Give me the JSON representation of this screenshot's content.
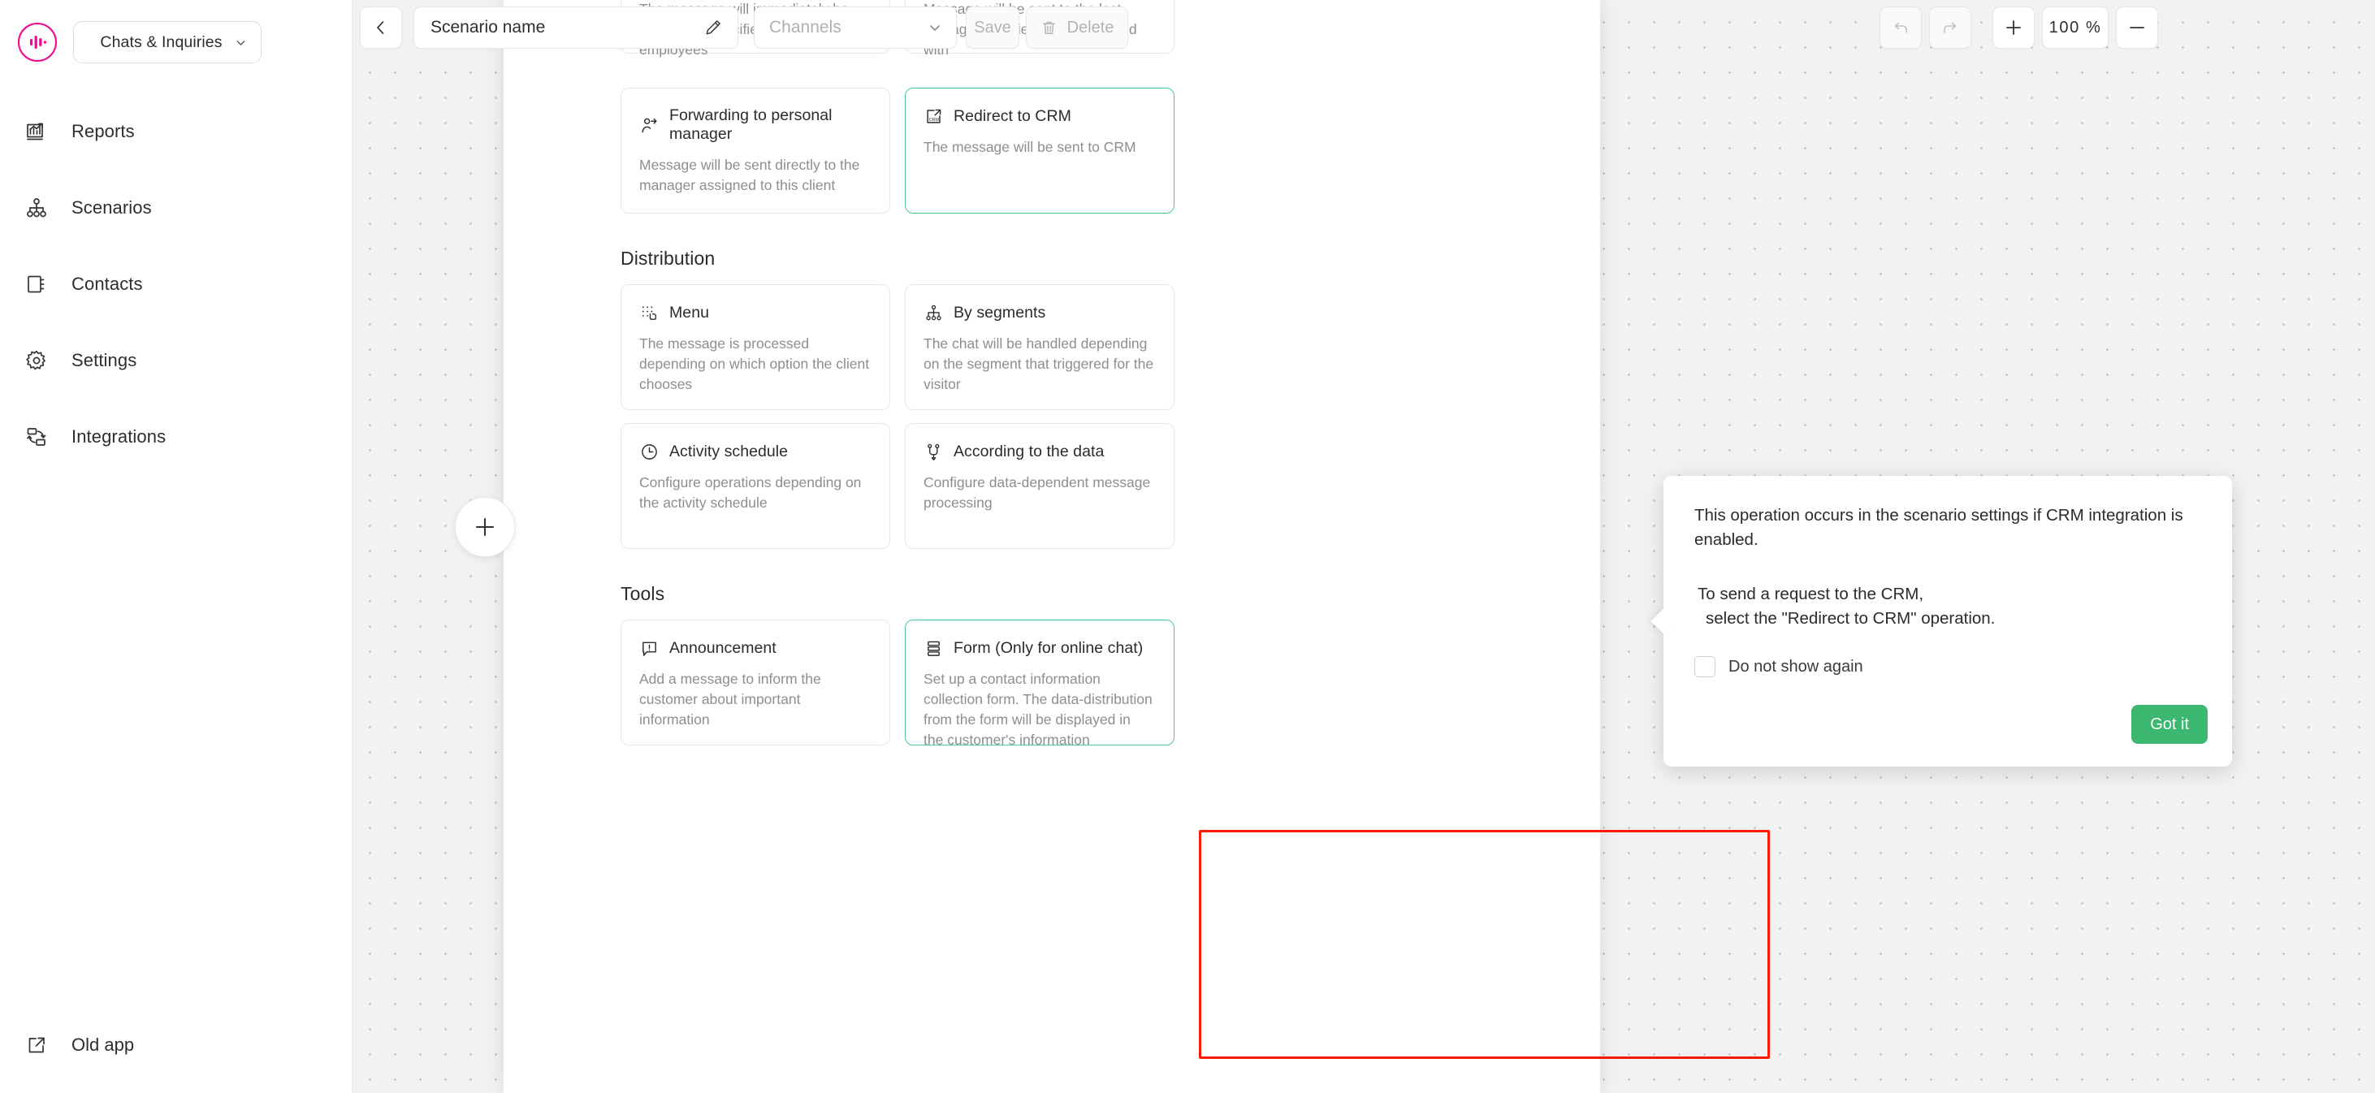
{
  "brand": {
    "accent_pink": "#f0068f",
    "accent_green": "#3bb76f",
    "selection_green": "#4ec98c",
    "annotation_red": "#ff1a00"
  },
  "sidebar": {
    "workspace": {
      "label": "Chats & Inquiries"
    },
    "items": [
      {
        "label": "Reports",
        "icon": "chart-report-icon"
      },
      {
        "label": "Scenarios",
        "icon": "scenarios-tree-icon"
      },
      {
        "label": "Contacts",
        "icon": "contacts-book-icon"
      },
      {
        "label": "Settings",
        "icon": "gear-icon"
      },
      {
        "label": "Integrations",
        "icon": "integrations-sync-icon"
      }
    ],
    "footer": {
      "label": "Old app",
      "icon": "external-link-icon"
    }
  },
  "toolbar": {
    "back_icon": "chevron-left-icon",
    "scenario_name": "Scenario name",
    "edit_icon": "pencil-icon",
    "channels_placeholder": "Channels",
    "channels_value": "",
    "save_label": "Save",
    "delete_label": "Delete",
    "delete_icon": "trash-icon",
    "undo_icon": "undo-arrow-icon",
    "redo_icon": "redo-arrow-icon",
    "zoom_in_icon": "plus-icon",
    "zoom_level": "100 %",
    "zoom_out_icon": "minus-icon"
  },
  "canvas": {
    "add_node_icon": "plus-icon"
  },
  "panel": {
    "partial_cards": [
      {
        "desc": "The message will immediately be sent to the specified group of employees",
        "selected": false
      },
      {
        "desc": "Message will be sent to the last manager the client communicated with",
        "selected": false
      }
    ],
    "sections": [
      {
        "title": "",
        "cards": [
          {
            "title": "Forwarding to personal manager",
            "desc": "Message will be sent directly to the manager assigned to this client",
            "icon": "user-forward-icon",
            "selected": false
          },
          {
            "title": "Redirect to CRM",
            "desc": "The message will be sent to CRM",
            "icon": "crm-external-icon",
            "selected": true
          }
        ]
      },
      {
        "title": "Distribution",
        "cards": [
          {
            "title": "Menu",
            "desc": "The message is processed depending on which option the client chooses",
            "icon": "menu-click-icon",
            "selected": false
          },
          {
            "title": "By segments",
            "desc": "The chat will be handled depending on the segment that triggered for the visitor",
            "icon": "segments-tree-icon",
            "selected": false
          },
          {
            "title": "Activity schedule",
            "desc": "Configure operations depending on the activity schedule",
            "icon": "clock-icon",
            "selected": false
          },
          {
            "title": "According to the data",
            "desc": "Configure data-dependent message processing",
            "icon": "data-branch-icon",
            "selected": false
          }
        ]
      },
      {
        "title": "Tools",
        "cards": [
          {
            "title": "Announcement",
            "desc": "Add a message to inform the customer about important information",
            "icon": "announcement-bubble-icon",
            "selected": false
          },
          {
            "title": "Form (Only for online chat)",
            "desc": "Set up a contact information collection form. The data-distribution from the form will be displayed in the customer's information",
            "icon": "form-rows-icon",
            "selected": true
          }
        ]
      }
    ]
  },
  "tooltip": {
    "paragraph1": "This operation occurs in the scenario settings if CRM integration is enabled.",
    "paragraph2_line1": "To send a request to the CRM,",
    "paragraph2_line2": "select the \"Redirect to CRM\" operation.",
    "checkbox_label": "Do not show again",
    "checkbox_checked": false,
    "button_label": "Got it"
  }
}
